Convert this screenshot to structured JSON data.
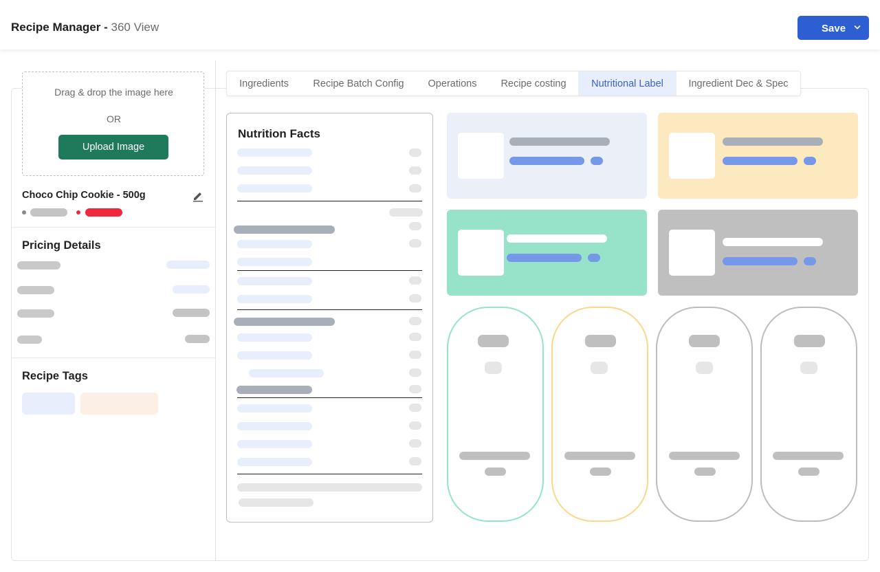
{
  "header": {
    "title": "Recipe Manager - ",
    "subtitle": "360 View",
    "save_label": "Save"
  },
  "upload": {
    "drag_text": "Drag & drop the image here",
    "or_text": "OR",
    "button_label": "Upload Image"
  },
  "product": {
    "name": "Choco Chip Cookie - 500g"
  },
  "sections": {
    "pricing": "Pricing Details",
    "tags": "Recipe Tags"
  },
  "tabs": [
    {
      "label": "Ingredients"
    },
    {
      "label": "Recipe Batch Config"
    },
    {
      "label": "Operations"
    },
    {
      "label": "Recipe costing"
    },
    {
      "label": "Nutritional Label",
      "active": true
    },
    {
      "label": "Ingredient Dec & Spec"
    }
  ],
  "nutrition": {
    "title": "Nutrition Facts"
  },
  "colors": {
    "accent": "#2d5fd3",
    "upload_green": "#1e7a5b",
    "status_red": "#f0283c",
    "tile_blue": "#ebeff8",
    "tile_yellow": "#fde9c0",
    "tile_green": "#97e3c9",
    "tile_grey": "#bfbfbf",
    "oval_green": "#97e3c9",
    "oval_yellow": "#fbd78a",
    "oval_grey": "#bdbdbd"
  }
}
